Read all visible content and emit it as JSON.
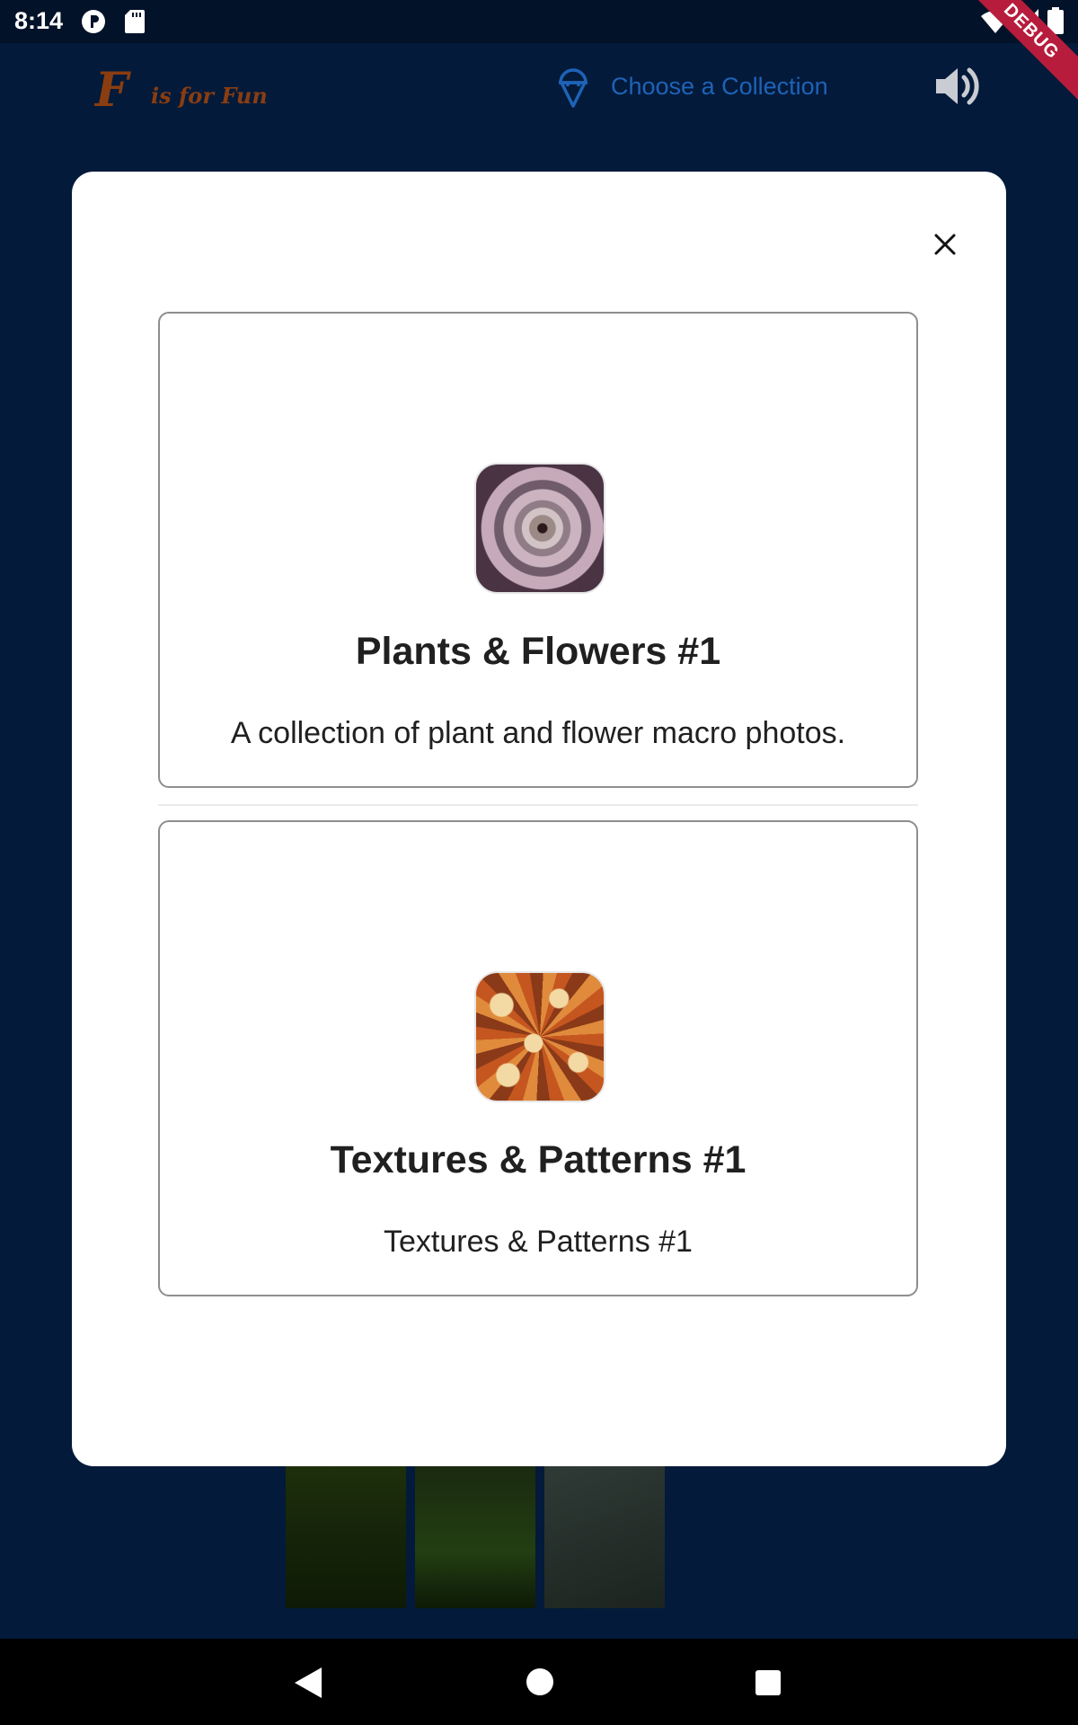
{
  "status_bar": {
    "time": "8:14",
    "icons": [
      "p-notification-icon",
      "sd-card-icon",
      "wifi-icon",
      "signal-icon",
      "battery-icon"
    ]
  },
  "debug_banner": "DEBUG",
  "app_bar": {
    "logo_f": "F",
    "logo_text": "is for Fun",
    "collection_label": "Choose a Collection",
    "collection_icon": "ice-cream-icon",
    "sound_icon": "volume-icon",
    "accent_color": "#1e63b8",
    "logo_color": "#8a3d10"
  },
  "modal": {
    "close_icon": "close-icon",
    "collections": [
      {
        "title": "Plants & Flowers #1",
        "description": "A collection of plant and flower macro photos."
      },
      {
        "title": "Textures & Patterns #1",
        "description": "Textures & Patterns #1"
      }
    ]
  },
  "nav_bar": {
    "icons": [
      "back-icon",
      "home-icon",
      "recents-icon"
    ]
  }
}
